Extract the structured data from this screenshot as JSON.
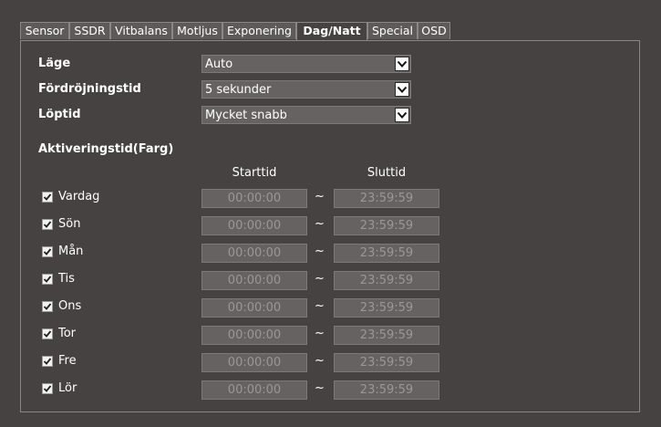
{
  "tabs": [
    {
      "label": "Sensor"
    },
    {
      "label": "SSDR"
    },
    {
      "label": "Vitbalans"
    },
    {
      "label": "Motljus"
    },
    {
      "label": "Exponering"
    },
    {
      "label": "Dag/Natt",
      "active": true
    },
    {
      "label": "Special"
    },
    {
      "label": "OSD"
    }
  ],
  "fields": {
    "mode": {
      "label": "Läge",
      "value": "Auto"
    },
    "delay": {
      "label": "Fördröjningstid",
      "value": "5 sekunder"
    },
    "runtime": {
      "label": "Löptid",
      "value": "Mycket snabb"
    }
  },
  "activation": {
    "title": "Aktiveringstid(Farg)",
    "start_header": "Starttid",
    "end_header": "Sluttid",
    "separator": "~",
    "days": [
      {
        "label": "Vardag",
        "checked": true,
        "start": "00:00:00",
        "end": "23:59:59"
      },
      {
        "label": "Sön",
        "checked": true,
        "start": "00:00:00",
        "end": "23:59:59"
      },
      {
        "label": "Mån",
        "checked": true,
        "start": "00:00:00",
        "end": "23:59:59"
      },
      {
        "label": "Tis",
        "checked": true,
        "start": "00:00:00",
        "end": "23:59:59"
      },
      {
        "label": "Ons",
        "checked": true,
        "start": "00:00:00",
        "end": "23:59:59"
      },
      {
        "label": "Tor",
        "checked": true,
        "start": "00:00:00",
        "end": "23:59:59"
      },
      {
        "label": "Fre",
        "checked": true,
        "start": "00:00:00",
        "end": "23:59:59"
      },
      {
        "label": "Lör",
        "checked": true,
        "start": "00:00:00",
        "end": "23:59:59"
      }
    ]
  }
}
